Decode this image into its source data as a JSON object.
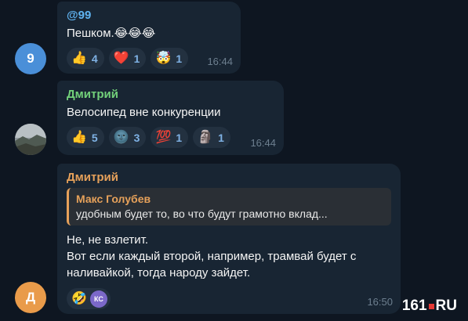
{
  "messages": [
    {
      "avatar_initial": "9",
      "author": "@99",
      "text": "Пешком.😂😂😂",
      "reactions": [
        {
          "emoji": "👍",
          "count": "4"
        },
        {
          "emoji": "❤️",
          "count": "1"
        },
        {
          "emoji": "🤯",
          "count": "1"
        }
      ],
      "time": "16:44",
      "colors": {
        "avatar": "#4a8fd8",
        "author": "#5fb3f0"
      }
    },
    {
      "author": "Дмитрий",
      "text": "Велосипед вне конкуренции",
      "reactions": [
        {
          "emoji": "👍",
          "count": "5"
        },
        {
          "emoji": "🌚",
          "count": "3"
        },
        {
          "emoji": "💯",
          "count": "1"
        },
        {
          "emoji": "🗿",
          "count": "1"
        }
      ],
      "time": "16:44",
      "colors": {
        "author": "#72d07a"
      }
    },
    {
      "avatar_initial": "Д",
      "author": "Дмитрий",
      "quote": {
        "author": "Макс Голубев",
        "text": "удобным будет то, во что будут грамотно вклад..."
      },
      "text_line1": "Не, не взлетит.",
      "text_line2": "Вот если каждый второй, например, трамвай будет с наливайкой, тогда народу зайдет.",
      "reactions": [
        {
          "emoji": "🤣"
        },
        {
          "initials": "КС"
        }
      ],
      "time": "16:50",
      "colors": {
        "avatar": "#e99b4a",
        "author": "#e6a15a"
      }
    }
  ],
  "watermark": {
    "left": "161",
    "right": "RU"
  }
}
